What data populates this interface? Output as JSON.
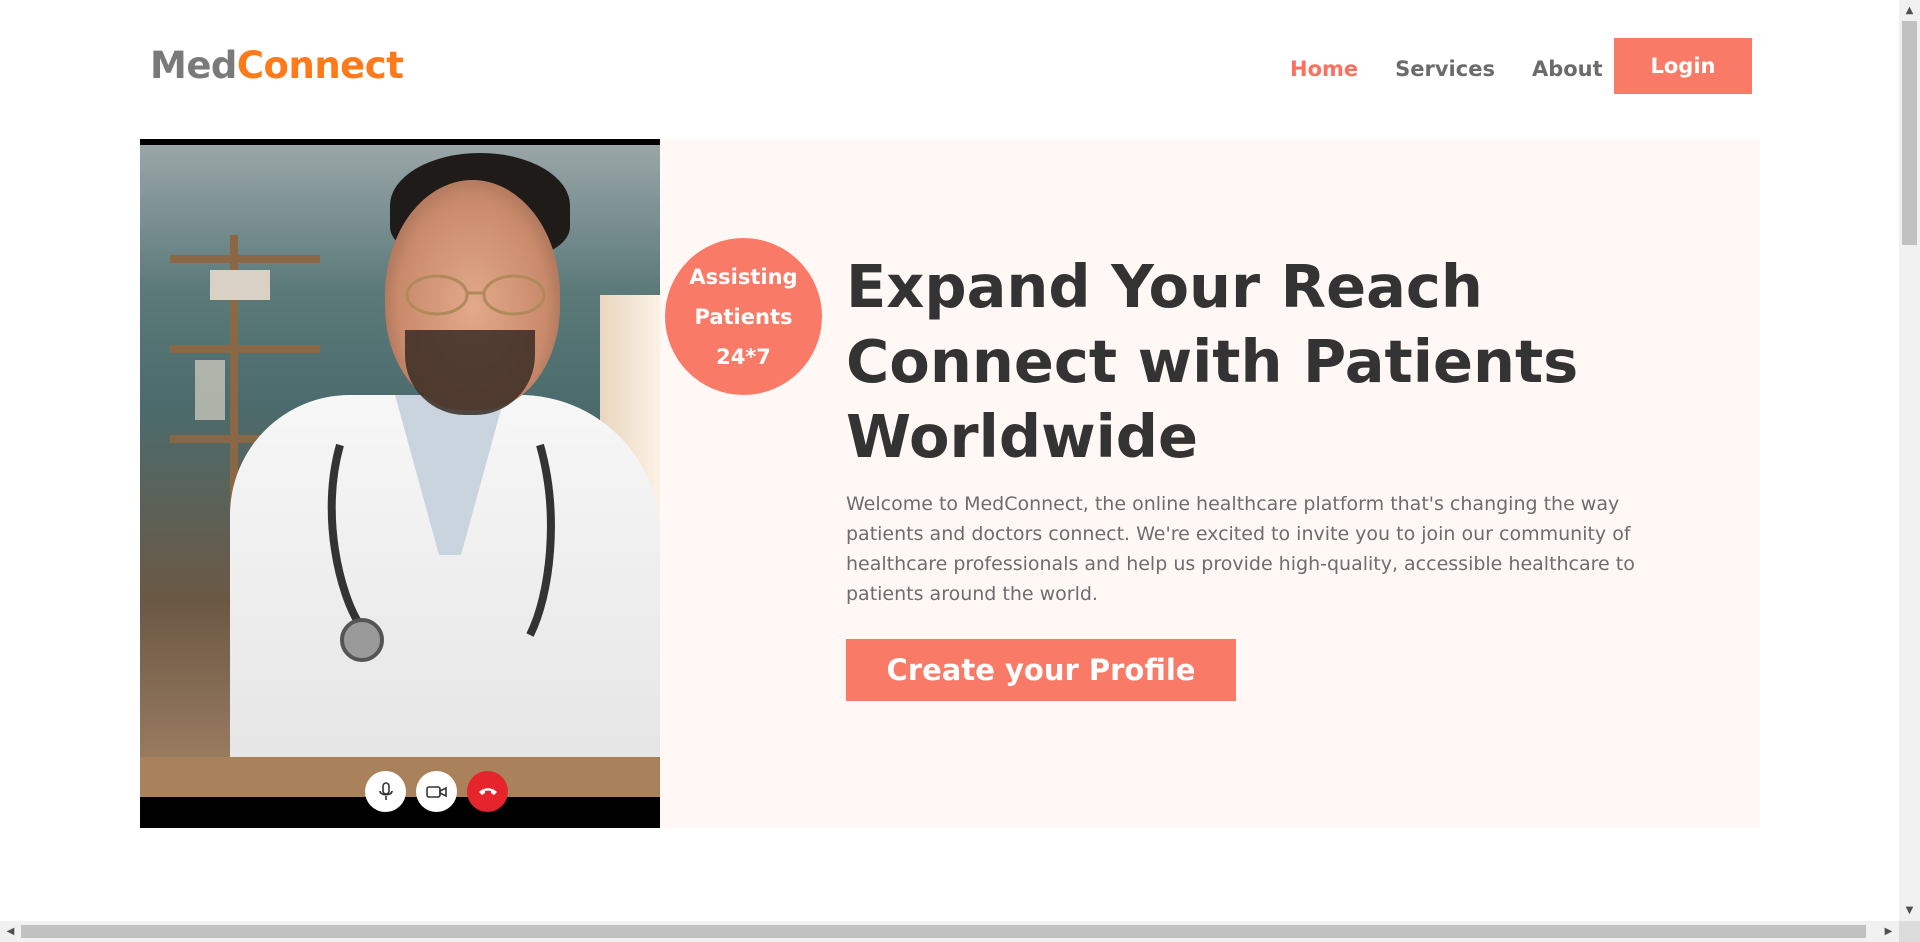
{
  "brand": {
    "part1": "Med",
    "part2": "Connect"
  },
  "nav": {
    "items": [
      {
        "label": "Home",
        "active": true
      },
      {
        "label": "Services",
        "active": false
      },
      {
        "label": "About",
        "active": false
      }
    ],
    "login_label": "Login"
  },
  "badge": {
    "line1": "Assisting",
    "line2": "Patients",
    "line3": "24*7"
  },
  "hero": {
    "headline_line1": "Expand Your Reach",
    "headline_line2": "Connect with Patients",
    "headline_line3": "Worldwide",
    "intro": "Welcome to MedConnect, the online healthcare platform that's changing the way patients and doctors connect. We're excited to invite you to join our community of healthcare professionals and help us provide high-quality, accessible healthcare to patients around the world.",
    "cta_label": "Create your Profile"
  },
  "video_call": {
    "controls": [
      {
        "icon": "microphone-icon"
      },
      {
        "icon": "video-camera-icon"
      },
      {
        "icon": "end-call-icon"
      }
    ]
  },
  "colors": {
    "accent": "#fa7a68",
    "brand_orange": "#ff7a1a",
    "brand_gray": "#7a7a7a",
    "hero_bg": "#fff8f5",
    "end_call_red": "#e5242c",
    "heading": "#333333"
  }
}
